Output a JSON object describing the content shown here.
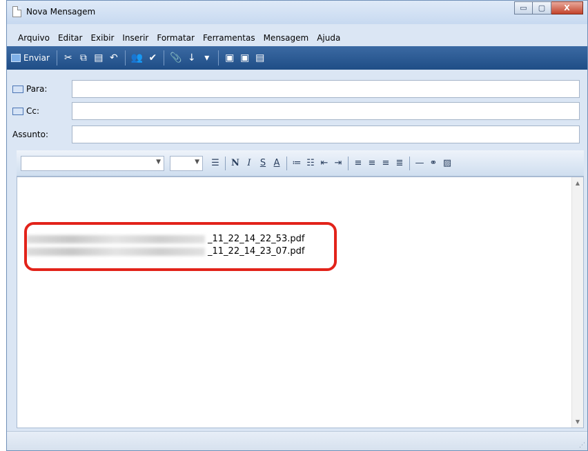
{
  "window": {
    "title": "Nova Mensagem",
    "buttons": [
      "▭",
      "▢",
      "X"
    ]
  },
  "menu": [
    "Arquivo",
    "Editar",
    "Exibir",
    "Inserir",
    "Formatar",
    "Ferramentas",
    "Mensagem",
    "Ajuda"
  ],
  "toolbar": {
    "send_label": "Enviar"
  },
  "headers": {
    "to_label": "Para:",
    "cc_label": "Cc:",
    "subject_label": "Assunto:",
    "to_value": "",
    "cc_value": "",
    "subject_value": ""
  },
  "attachments": [
    {
      "name_suffix": "_11_22_14_22_53.pdf"
    },
    {
      "name_suffix": "_11_22_14_23_07.pdf"
    }
  ],
  "colors": {
    "toolbar": "#1f4d86",
    "highlight": "#e2231a"
  }
}
